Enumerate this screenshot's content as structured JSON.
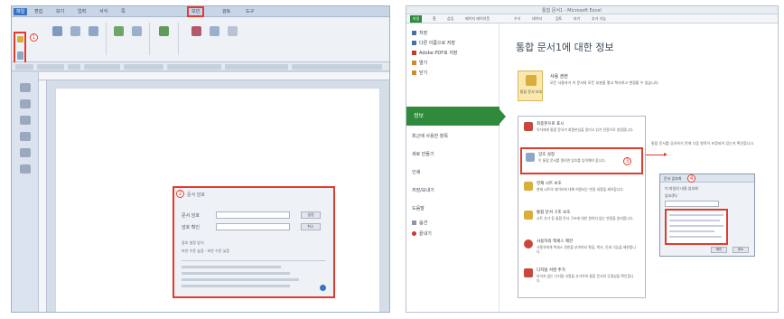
{
  "left_window": {
    "menus": [
      "파일",
      "편집",
      "보기",
      "입력",
      "서식",
      "쪽",
      "보안",
      "검토",
      "도구"
    ],
    "active_menu_index": 0,
    "boxed_menu_index": 6,
    "badge_1": "1",
    "badge_2": "2",
    "dialog": {
      "title": "문서 암호",
      "field1_label": "문서 암호",
      "field2_label": "암호 확인",
      "ok_label": "설정",
      "cancel_label": "취소",
      "note_line1": "암호 설정 방식",
      "note_line2": "보안 수준 높음 · 보안 수준 낮음"
    }
  },
  "right_window": {
    "tabs": [
      "파일",
      "홈",
      "삽입",
      "페이지 레이아웃",
      "수식",
      "데이터",
      "검토",
      "보기",
      "추가 기능"
    ],
    "app_title": "통합 문서1 - Microsoft Excel",
    "nav": {
      "items_top": [
        "저장",
        "다른 이름으로 저장",
        "Adobe PDF로 저장",
        "열기",
        "닫기"
      ],
      "active": "정보",
      "items_bottom": [
        "최근에 사용한 항목",
        "새로 만들기",
        "인쇄",
        "저장/보내기",
        "도움말",
        "옵션",
        "끝내기"
      ]
    },
    "heading": "통합 문서1에 대한 정보",
    "big_button_label": "통합 문서 보호",
    "info_title": "사용 권한",
    "info_desc": "모든 사용자가 이 문서의 모든 부분을 열고 복사하고 변경할 수 있습니다.",
    "menu_items": [
      {
        "title": "최종본으로 표시",
        "desc": "독자에게 통합 문서가 최종본임을 알리고 읽기 전용으로 설정합니다."
      },
      {
        "title": "암호 설정",
        "desc": "이 통합 문서를 열려면 암호를 입력해야 합니다."
      },
      {
        "title": "현재 시트 보호",
        "desc": "현재 시트의 데이터에 대해 허용되는 변경 내용을 제어합니다."
      },
      {
        "title": "통합 문서 구조 보호",
        "desc": "시트 추가 등 통합 문서 구조에 대한 원하지 않는 변경을 방지합니다."
      },
      {
        "title": "사용자의 액세스 제한",
        "desc": "사용자에게 액세스 권한을 부여하되 편집, 복사, 인쇄 기능을 제한합니다."
      },
      {
        "title": "디지털 서명 추가",
        "desc": "보이지 않는 디지털 서명을 추가하여 통합 문서의 무결성을 확인합니다."
      }
    ],
    "side_note": "통합 문서를 공유하기 전에 다음 항목이 포함되어 있는지 확인합니다.",
    "badge_3": "3",
    "badge_4": "4",
    "dialog": {
      "title": "문서 암호화",
      "line1": "이 파일의 내용 암호화",
      "line2": "암호(R):",
      "ok": "확인",
      "cancel": "취소"
    }
  }
}
